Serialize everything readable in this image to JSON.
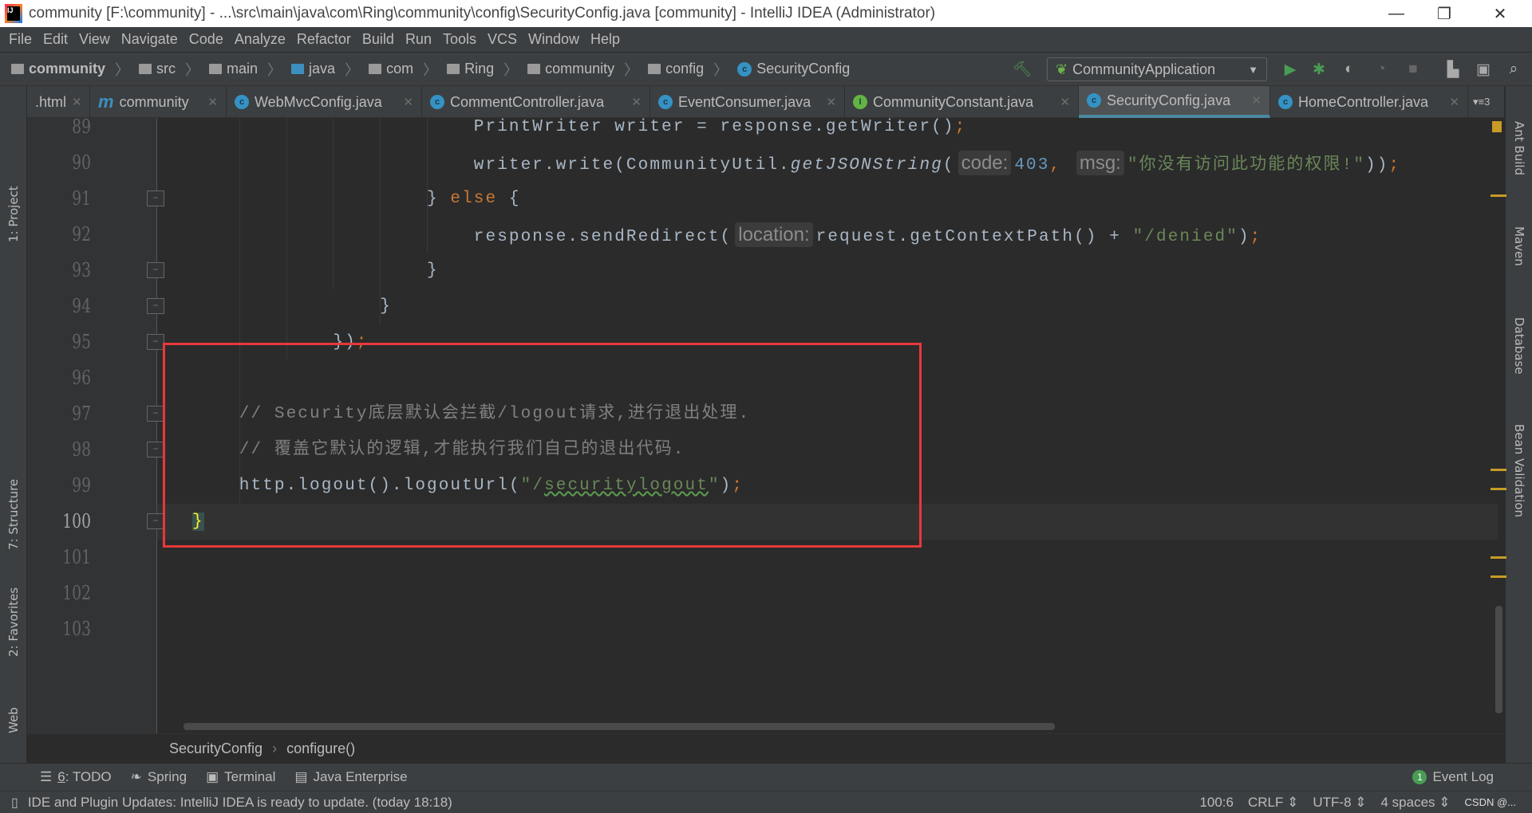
{
  "window": {
    "title": "community [F:\\community] - ...\\src\\main\\java\\com\\Ring\\community\\config\\SecurityConfig.java [community] - IntelliJ IDEA (Administrator)",
    "minimize": "—",
    "restore": "❐",
    "close": "✕"
  },
  "menu": [
    "File",
    "Edit",
    "View",
    "Navigate",
    "Code",
    "Analyze",
    "Refactor",
    "Build",
    "Run",
    "Tools",
    "VCS",
    "Window",
    "Help"
  ],
  "breadcrumb": [
    "community",
    "src",
    "main",
    "java",
    "com",
    "Ring",
    "community",
    "config",
    "SecurityConfig"
  ],
  "toolbar": {
    "run_config": "CommunityApplication"
  },
  "tabs": [
    {
      "label": ".html"
    },
    {
      "label": "community"
    },
    {
      "label": "WebMvcConfig.java"
    },
    {
      "label": "CommentController.java"
    },
    {
      "label": "EventConsumer.java"
    },
    {
      "label": "CommunityConstant.java"
    },
    {
      "label": "SecurityConfig.java",
      "active": true
    },
    {
      "label": "HomeController.java"
    }
  ],
  "tabs_overflow": "▾≡3",
  "left_tools": [
    "1: Project",
    "7: Structure",
    "2: Favorites",
    "Web"
  ],
  "right_tools": [
    "Ant Build",
    "Maven",
    "Database",
    "Bean Validation"
  ],
  "code": {
    "lines": [
      {
        "num": "89",
        "indent": 24,
        "tokens": [
          {
            "t": "PrintWriter writer = response.getWriter()"
          },
          {
            "t": ";",
            "c": "k"
          }
        ]
      },
      {
        "num": "90",
        "indent": 24,
        "tokens": [
          {
            "t": "writer.write(CommunityUtil."
          },
          {
            "t": "getJSONString",
            "c": "it"
          },
          {
            "t": "("
          },
          {
            "t": "code:",
            "c": "hint"
          },
          {
            "t": "403",
            "c": "n"
          },
          {
            "t": ", ",
            "c": "k"
          },
          {
            "t": "msg:",
            "c": "hint"
          },
          {
            "t": "\"你没有访问此功能的权限!\"",
            "c": "s"
          },
          {
            "t": "))"
          },
          {
            "t": ";",
            "c": "k"
          }
        ]
      },
      {
        "num": "91",
        "indent": 20,
        "tokens": [
          {
            "t": "} "
          },
          {
            "t": "else",
            "c": "k"
          },
          {
            "t": " {"
          }
        ]
      },
      {
        "num": "92",
        "indent": 24,
        "tokens": [
          {
            "t": "response.sendRedirect("
          },
          {
            "t": "location:",
            "c": "hint"
          },
          {
            "t": "request.getContextPath() + "
          },
          {
            "t": "\"/denied\"",
            "c": "s"
          },
          {
            "t": ")"
          },
          {
            "t": ";",
            "c": "k"
          }
        ]
      },
      {
        "num": "93",
        "indent": 20,
        "tokens": [
          {
            "t": "}"
          }
        ]
      },
      {
        "num": "94",
        "indent": 16,
        "tokens": [
          {
            "t": "}"
          }
        ]
      },
      {
        "num": "95",
        "indent": 12,
        "tokens": [
          {
            "t": "})"
          },
          {
            "t": ";",
            "c": "k"
          }
        ]
      },
      {
        "num": "96",
        "indent": 0,
        "tokens": []
      },
      {
        "num": "97",
        "indent": 4,
        "tokens": [
          {
            "t": "// Security底层默认会拦截/logout请求,进行退出处理.",
            "c": "cm"
          }
        ]
      },
      {
        "num": "98",
        "indent": 4,
        "tokens": [
          {
            "t": "// 覆盖它默认的逻辑,才能执行我们自己的退出代码.",
            "c": "cm"
          }
        ]
      },
      {
        "num": "99",
        "indent": 4,
        "tokens": [
          {
            "t": "http.logout().logoutUrl("
          },
          {
            "t": "\"/",
            "c": "s"
          },
          {
            "t": "securitylogout",
            "c": "s wavy"
          },
          {
            "t": "\"",
            "c": "s"
          },
          {
            "t": ")"
          },
          {
            "t": ";",
            "c": "k"
          }
        ]
      },
      {
        "num": "100",
        "indent": 0,
        "current": true,
        "tokens": [
          {
            "t": "}",
            "c": "brace-hl"
          }
        ]
      },
      {
        "num": "101",
        "indent": 0,
        "tokens": []
      },
      {
        "num": "102",
        "indent": 0,
        "tokens": []
      },
      {
        "num": "103",
        "indent": 0,
        "tokens": []
      }
    ]
  },
  "editor_breadcrumb": [
    "SecurityConfig",
    "configure()"
  ],
  "tool_windows": [
    {
      "num": "6",
      "label": ": TODO"
    },
    {
      "label": "Spring"
    },
    {
      "label": "Terminal"
    },
    {
      "label": "Java Enterprise"
    }
  ],
  "event_log": {
    "count": "1",
    "label": "Event Log"
  },
  "status": {
    "message": "IDE and Plugin Updates: IntelliJ IDEA is ready to update. (today 18:18)",
    "position": "100:6",
    "line_sep": "CRLF",
    "encoding": "UTF-8",
    "indent": "4 spaces",
    "watermark": "CSDN @..."
  }
}
